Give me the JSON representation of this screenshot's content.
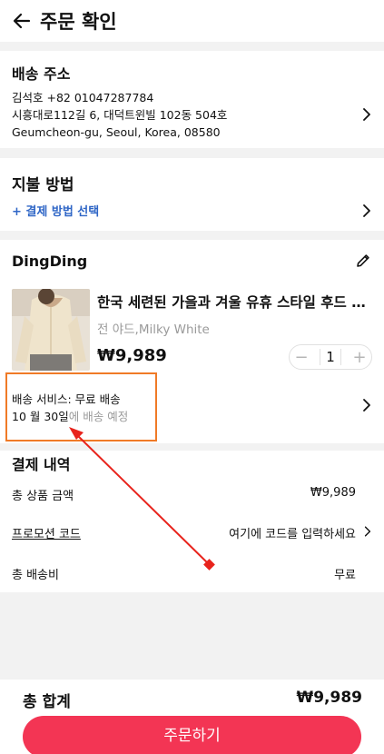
{
  "header": {
    "title": "주문 확인",
    "back_icon": "arrow-left-icon"
  },
  "address": {
    "title": "배송 주소",
    "name_phone": "김석호 +82 01047287784",
    "line1": "시흥대로112길 6, 대덕트윈빌 102동 504호",
    "line2": "Geumcheon-gu, Seoul, Korea, 08580"
  },
  "payment": {
    "title": "지불 방법",
    "select_label": "+ 결제 방법 선택"
  },
  "store": {
    "name": "DingDing",
    "product": {
      "name": "한국 세련된 가을과 겨울 유휴 스타일 후드 크…",
      "variant": "전 야드,Milky White",
      "price": "₩9,989",
      "quantity": "1"
    },
    "shipping": {
      "service": "배송 서비스: 무료 배송",
      "date": "10 월 30일",
      "date_suffix": "에 배송 예정"
    }
  },
  "summary": {
    "title": "결제 내역",
    "subtotal_label": "총 상품 금액",
    "subtotal_value": "₩9,989",
    "promo_label": "프로모션 코드",
    "promo_placeholder": "여기에 코드를 입력하세요",
    "shipping_label": "총 배송비",
    "shipping_value": "무료"
  },
  "footer": {
    "total_label": "총 합계",
    "total_value": "₩9,989",
    "order_button": "주문하기"
  },
  "colors": {
    "accent": "#f33554",
    "link": "#2f66c6",
    "annotation_box": "#f07a27",
    "annotation_arrow": "#e8231c"
  }
}
